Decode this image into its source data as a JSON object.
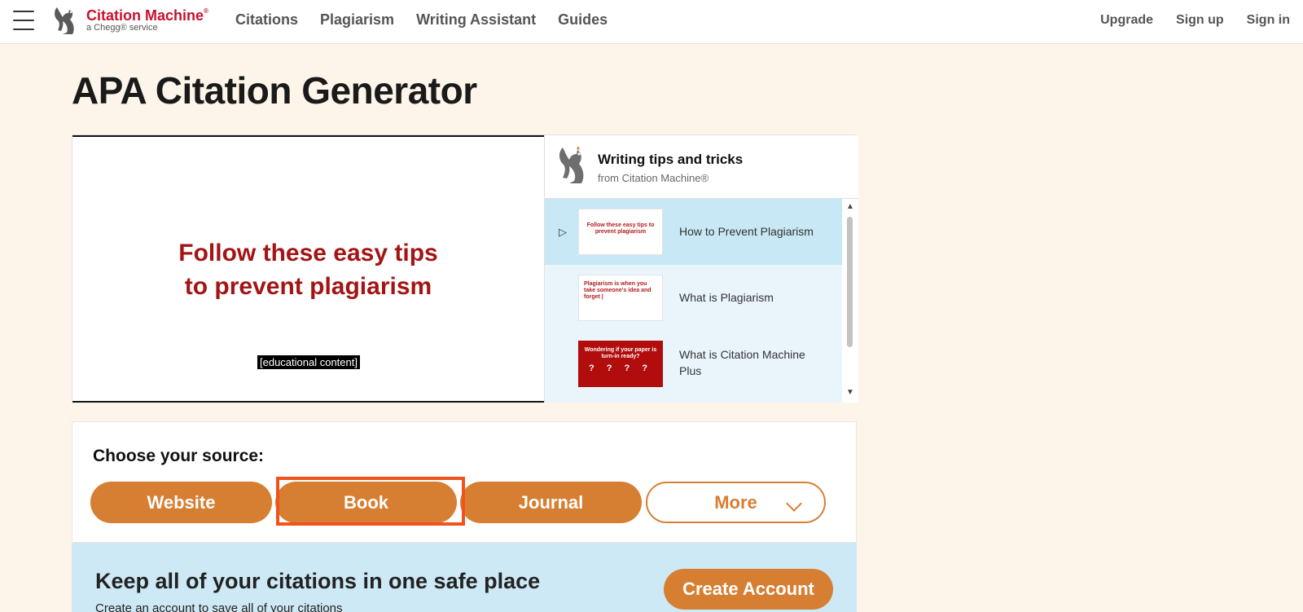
{
  "header": {
    "logo_name": "Citation Machine",
    "logo_registered": "®",
    "logo_sub": "a Chegg® service",
    "nav": [
      "Citations",
      "Plagiarism",
      "Writing Assistant",
      "Guides"
    ],
    "nav_right": [
      "Upgrade",
      "Sign up",
      "Sign in"
    ],
    "brand_color": "#c8102e"
  },
  "page_title": "APA Citation Generator",
  "video": {
    "headline_line1": "Follow these easy tips",
    "headline_line2": "to prevent plagiarism",
    "caption": "[educational content]"
  },
  "playlist": {
    "title": "Writing tips and tricks",
    "subtitle": "from Citation Machine®",
    "items": [
      {
        "label": "How to Prevent Plagiarism",
        "thumb_text": "Follow these easy tips to prevent plagiarism",
        "active": true
      },
      {
        "label": "What is Plagiarism",
        "thumb_text": "Plagiarism is when you take someone's idea and forget |",
        "active": false
      },
      {
        "label": "What is Citation Machine Plus",
        "thumb_text": "Wondering if your paper is turn-in ready?",
        "thumb_marks": "? ? ? ?",
        "active": false
      }
    ]
  },
  "source": {
    "label": "Choose your source:",
    "buttons": [
      "Website",
      "Book",
      "Journal"
    ],
    "more": "More",
    "accent_color": "#d67f33",
    "highlight_color": "#f0541e"
  },
  "account": {
    "title": "Keep all of your citations in one safe place",
    "subtitle": "Create an account to save all of your citations",
    "button": "Create Account"
  }
}
